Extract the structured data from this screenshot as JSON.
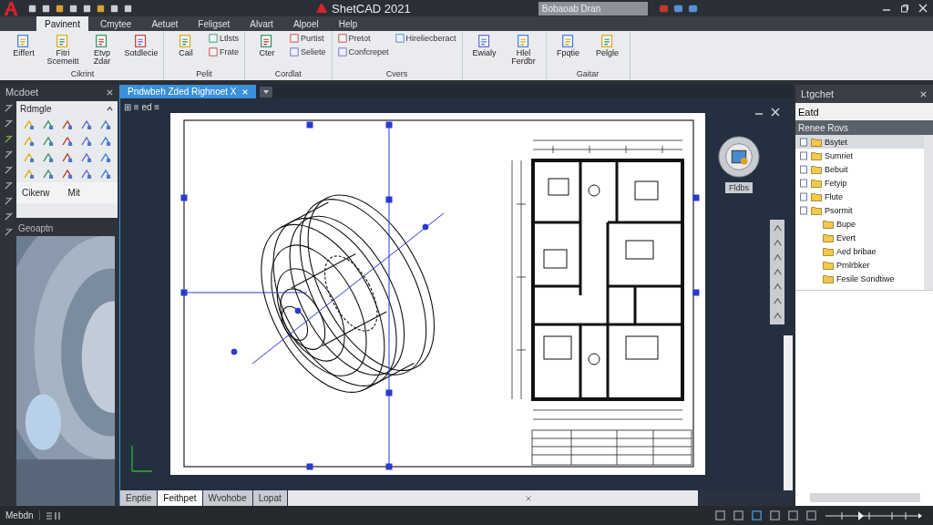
{
  "app": {
    "title": "ShetCAD 2021",
    "search": {
      "placeholder": "Bobaoab Dran"
    }
  },
  "ribbon": {
    "tabs": [
      {
        "label": "Pavinent",
        "selected": true
      },
      {
        "label": "Cmytee",
        "selected": false
      },
      {
        "label": "Aetuet",
        "selected": false
      },
      {
        "label": "Feligset",
        "selected": false
      },
      {
        "label": "Alvart",
        "selected": false
      },
      {
        "label": "Alpoel",
        "selected": false
      },
      {
        "label": "Help",
        "selected": false
      }
    ],
    "groups": [
      {
        "label": "Cikrint",
        "buttons": [
          {
            "kind": "large",
            "label": "Eiffert"
          },
          {
            "kind": "large",
            "label": "Fitri Scemeitt"
          },
          {
            "kind": "large",
            "label": "Etvp Zdar"
          },
          {
            "kind": "large",
            "label": "Sotdlecie"
          }
        ]
      },
      {
        "label": "Pelit",
        "buttons": [
          {
            "kind": "large",
            "label": "Cail"
          },
          {
            "kind": "small",
            "label": "Ltlsts"
          },
          {
            "kind": "small",
            "label": "Frate"
          }
        ]
      },
      {
        "label": "Cordlat",
        "buttons": [
          {
            "kind": "large",
            "label": "Cter"
          },
          {
            "kind": "small",
            "label": "Purtist"
          },
          {
            "kind": "small",
            "label": "Seliete"
          }
        ]
      },
      {
        "label": "Cvers",
        "buttons": [
          {
            "kind": "small",
            "label": "Pretot"
          },
          {
            "kind": "small",
            "label": "Confcrepet"
          },
          {
            "kind": "small",
            "label": "Hireliecberact"
          }
        ]
      },
      {
        "buttons": [
          {
            "kind": "large",
            "label": "Ewialy"
          },
          {
            "kind": "large",
            "label": "Hlel Ferdbr"
          }
        ]
      },
      {
        "label": "Gaitar",
        "buttons": [
          {
            "kind": "large",
            "label": "Fpqtie"
          },
          {
            "kind": "large",
            "label": "Pelgle"
          }
        ]
      }
    ]
  },
  "palette": {
    "title": "Mcdoet",
    "section": "Rdmgle",
    "links": [
      "Cikerw",
      "Mit"
    ]
  },
  "preview": {
    "title": "Geoaptn"
  },
  "document": {
    "tab": "Pndwbeh Zded Righnoet X",
    "viewport_label": "⊞ ≡ ed ≡",
    "nav_label": "Fldbs",
    "layout_tabs": [
      {
        "label": "Enptie",
        "selected": false
      },
      {
        "label": "Feithpet",
        "selected": true
      },
      {
        "label": "Wvohobe",
        "selected": false
      },
      {
        "label": "Lopat",
        "selected": false
      }
    ]
  },
  "browser": {
    "title": "Ltgchet",
    "search": "Eatd",
    "heading": "Renee Rovs",
    "items": [
      {
        "label": "Bsytet",
        "selected": true
      },
      {
        "label": "Sumriet",
        "selected": false
      },
      {
        "label": "Bebuit",
        "selected": false
      },
      {
        "label": "Fetyip",
        "selected": false
      },
      {
        "label": "Flute",
        "selected": false
      },
      {
        "label": "Psormit",
        "selected": false,
        "children": [
          {
            "label": "Bupe",
            "selected": false
          },
          {
            "label": "Evert",
            "selected": false
          },
          {
            "label": "Aed bribae",
            "selected": false
          },
          {
            "label": "Prnlrbker",
            "selected": false
          },
          {
            "label": "Fesile Sondtiwe",
            "selected": false
          }
        ]
      }
    ]
  },
  "status_bar": {
    "mode": "Mebdn"
  }
}
